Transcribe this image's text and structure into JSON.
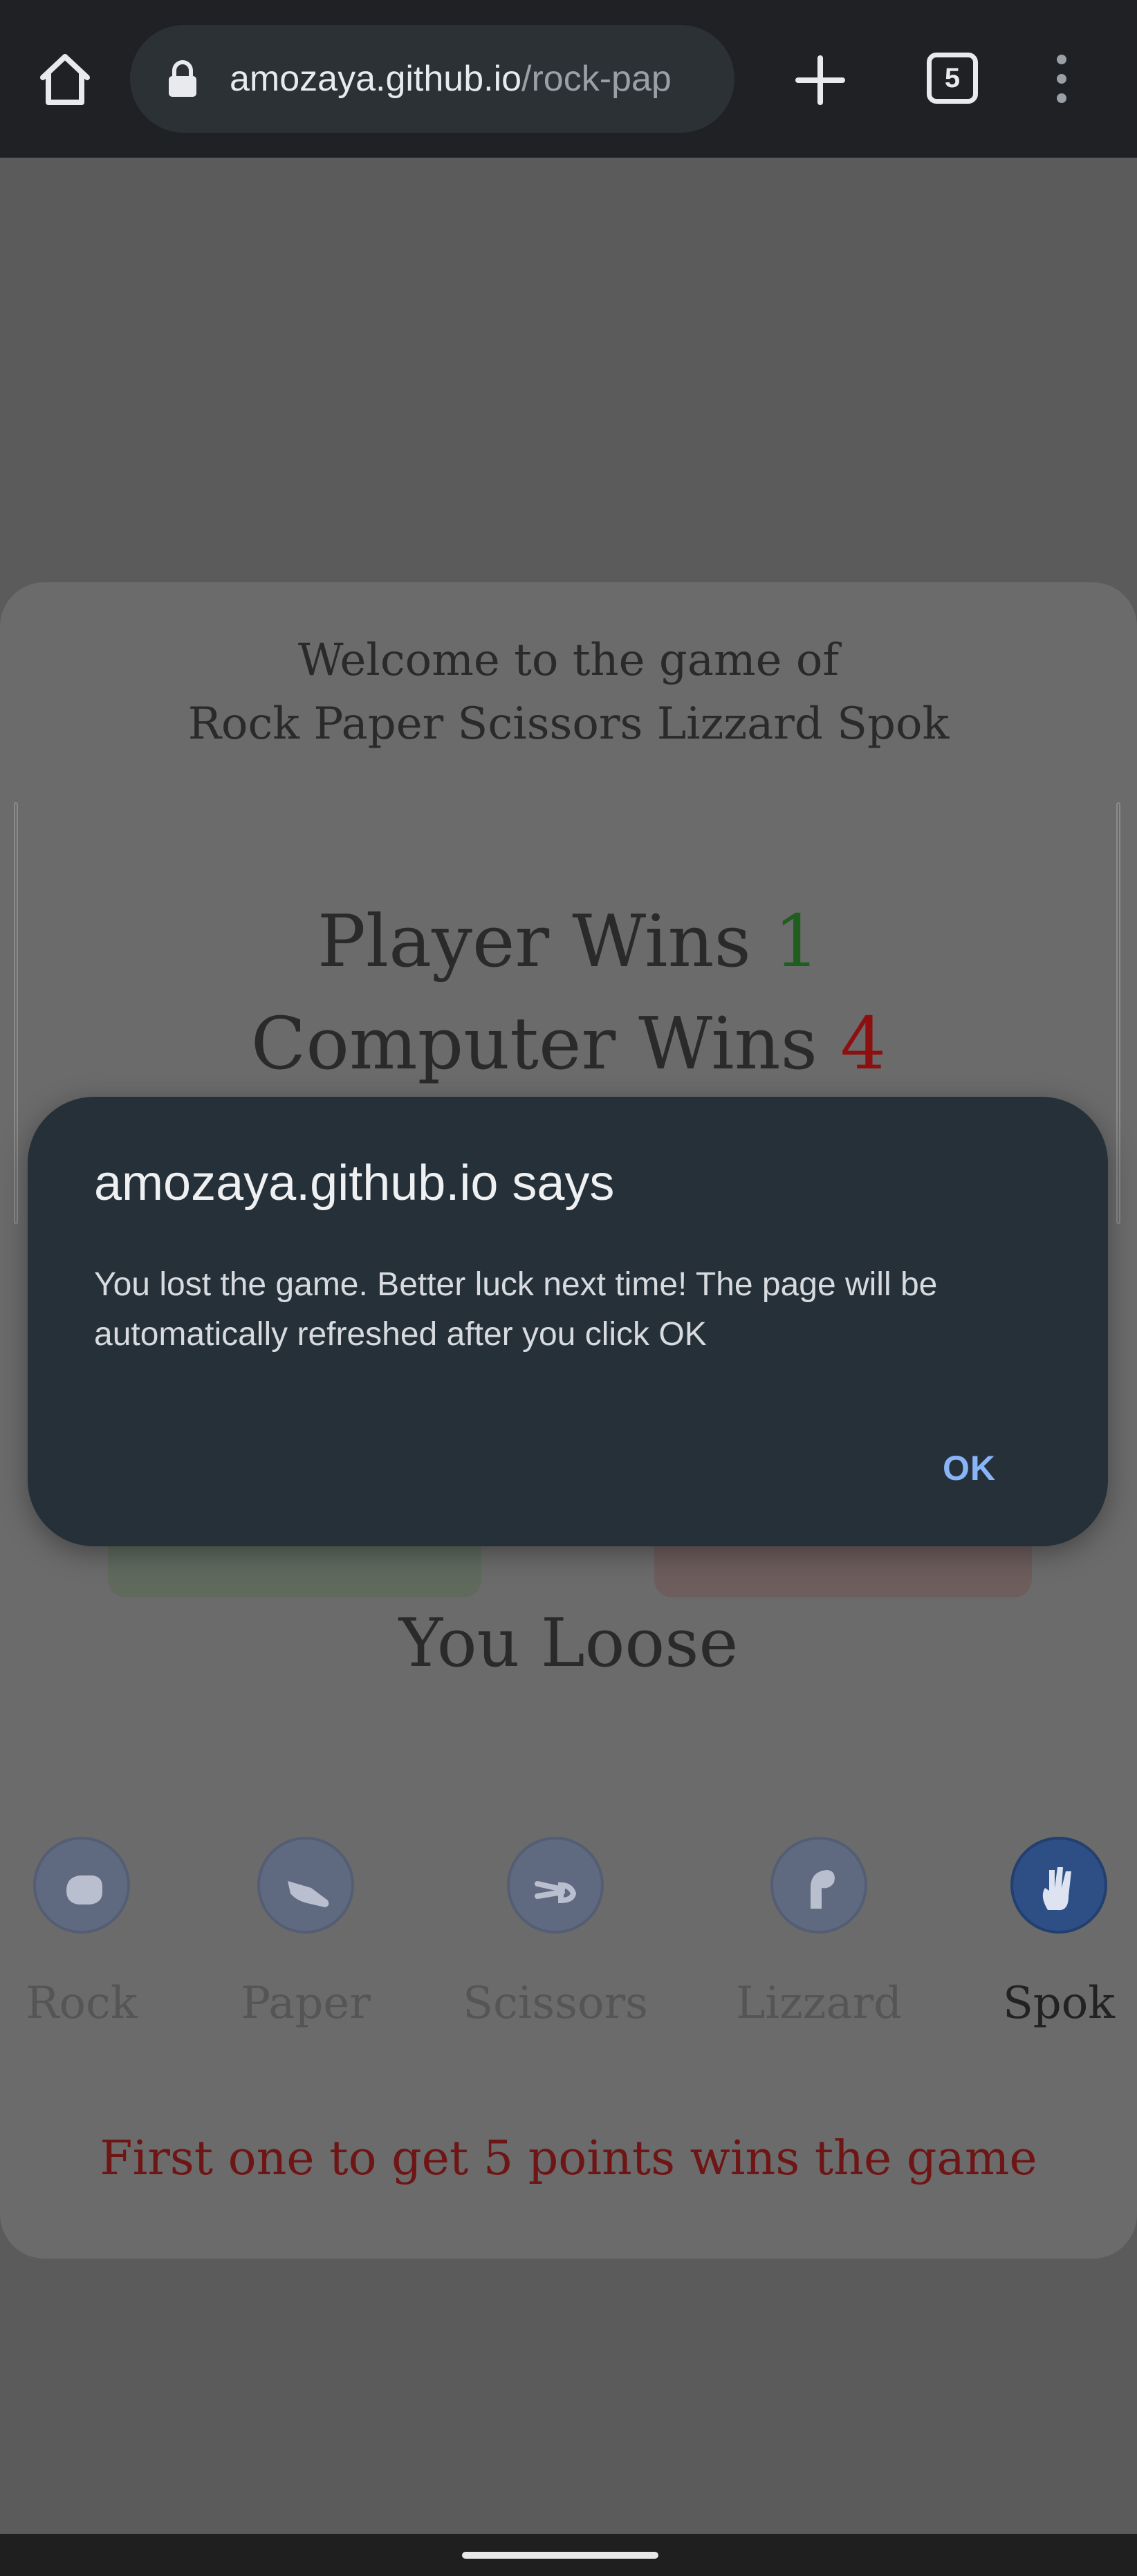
{
  "browser": {
    "url_host": "amozaya.github.io",
    "url_path": "/rock-pap",
    "tab_count": "5",
    "icons": [
      "home-icon",
      "lock-icon",
      "plus-icon",
      "tabs-icon",
      "more-vert-icon"
    ]
  },
  "page": {
    "welcome_line1": "Welcome to the game of",
    "welcome_line2": "Rock Paper Scissors Lizzard Spok",
    "player_label": "Player Wins",
    "player_score": "1",
    "computer_label": "Computer Wins",
    "computer_score": "4",
    "result": "You Loose",
    "choices": [
      {
        "label": "Rock",
        "icon": "rock-hand-icon"
      },
      {
        "label": "Paper",
        "icon": "paper-hand-icon"
      },
      {
        "label": "Scissors",
        "icon": "scissors-hand-icon"
      },
      {
        "label": "Lizzard",
        "icon": "lizard-hand-icon"
      },
      {
        "label": "Spok",
        "icon": "spock-hand-icon"
      }
    ],
    "selected_choice": "Spok",
    "rules": "First one to get 5 points wins the game",
    "colors": {
      "player_score": "#1f5e1f",
      "computer_score": "#8c1010",
      "rules": "#6e1515"
    }
  },
  "dialog": {
    "title": "amozaya.github.io says",
    "message": "You lost the game. Better luck next time! The page will be automatically refreshed after you click OK",
    "ok_label": "OK"
  }
}
